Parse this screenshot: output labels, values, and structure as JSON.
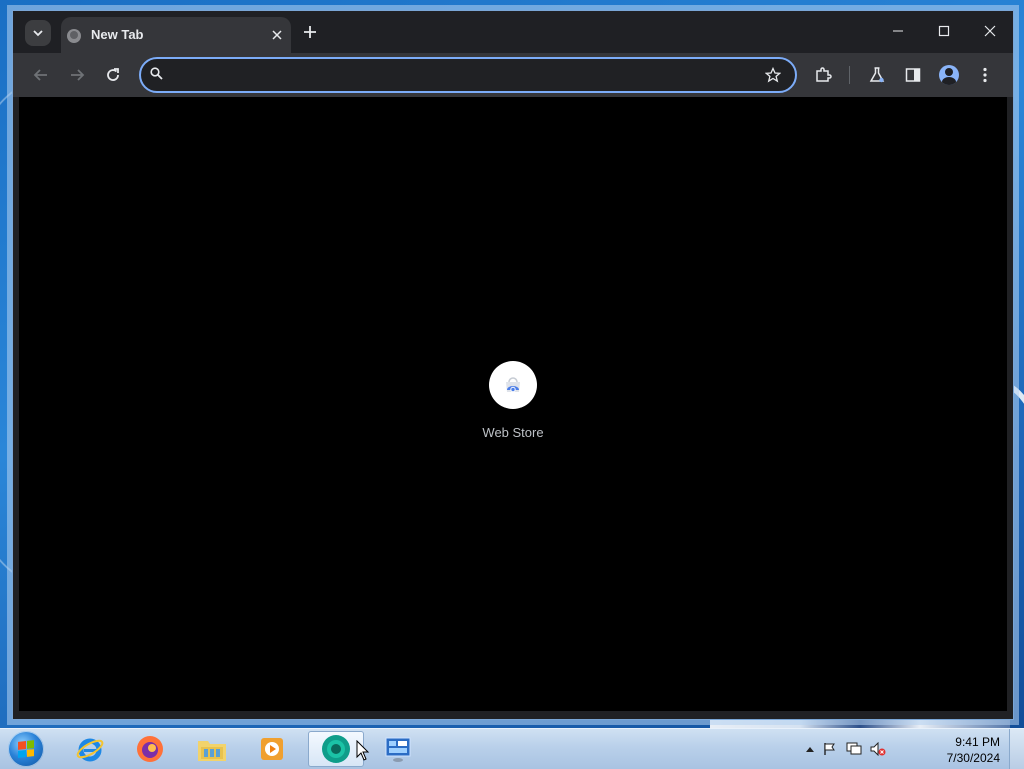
{
  "browser": {
    "tab": {
      "title": "New Tab",
      "close_label": "×"
    },
    "omnibox": {
      "value": "",
      "placeholder": ""
    }
  },
  "new_tab_page": {
    "shortcuts": [
      {
        "label": "Web Store"
      }
    ]
  },
  "taskbar": {
    "apps": [
      "internet-explorer",
      "firefox",
      "file-explorer",
      "media-player",
      "chrome",
      "control-panel"
    ],
    "clock": {
      "time": "9:41 PM",
      "date": "7/30/2024"
    }
  },
  "colors": {
    "window_bg": "#202124",
    "toolbar_bg": "#35363a",
    "omnibox_border": "#7cacf8",
    "content_bg": "#000000",
    "taskbar_bg": "#b9d0ea"
  }
}
